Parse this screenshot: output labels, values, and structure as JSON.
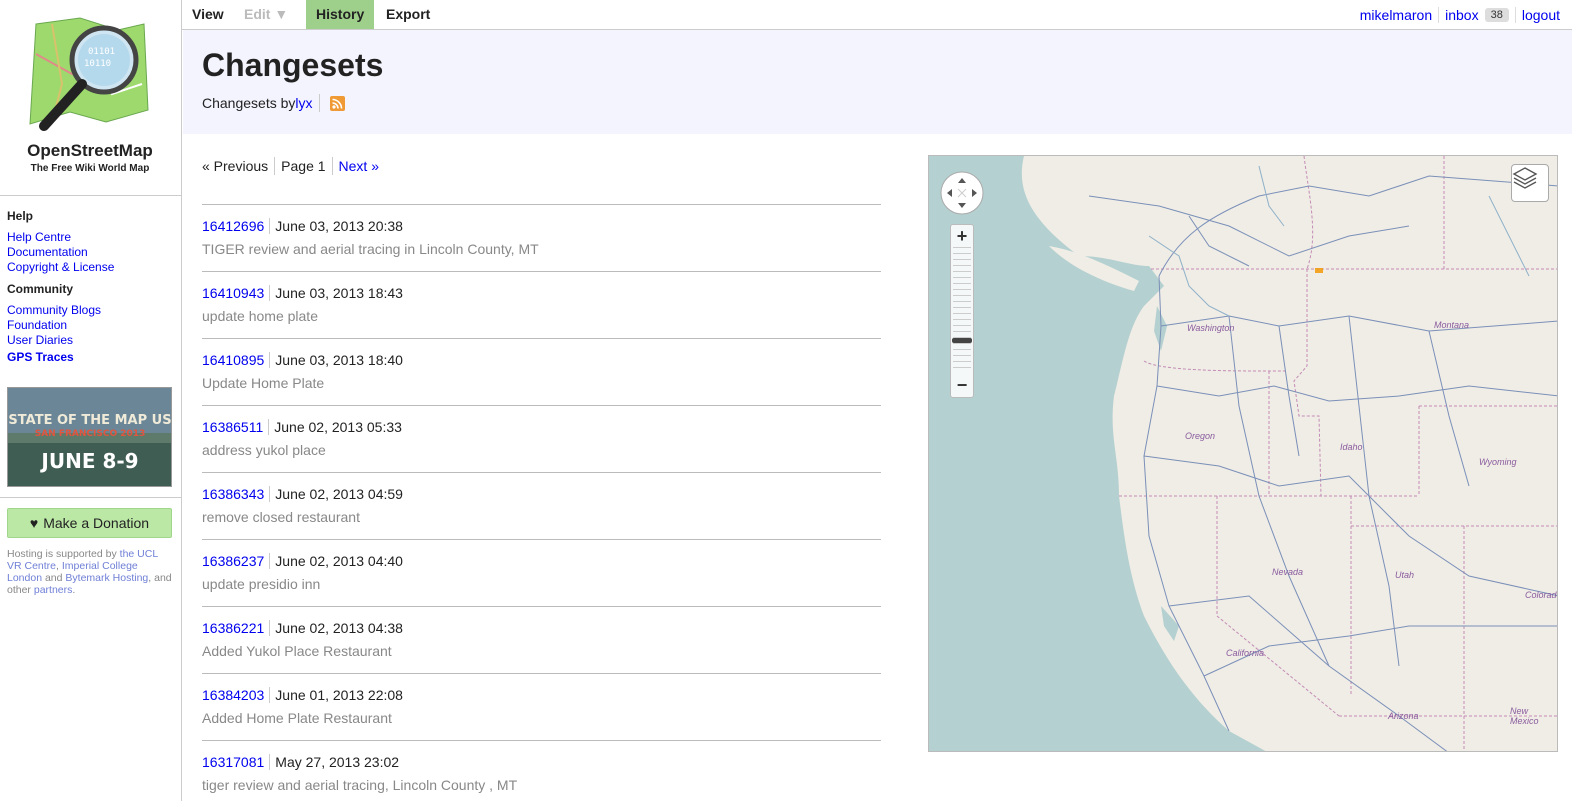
{
  "site": {
    "name": "OpenStreetMap",
    "tagline": "The Free Wiki World Map"
  },
  "sidebar": {
    "help_heading": "Help",
    "help_links": [
      "Help Centre",
      "Documentation",
      "Copyright & License"
    ],
    "community_heading": "Community",
    "community_links": [
      "Community Blogs",
      "Foundation",
      "User Diaries"
    ],
    "gps_traces": "GPS Traces",
    "banner": {
      "line1": "STATE OF THE MAP US",
      "line2": "SAN FRANCISCO 2013",
      "line3": "JUNE 8-9"
    },
    "donate_label": "Make a Donation",
    "hosting": {
      "t1": "Hosting is supported by ",
      "l1": "the UCL VR Centre",
      "t2": ", ",
      "l2": "Imperial College London",
      "t3": " and ",
      "l3": "Bytemark Hosting",
      "t4": ", and other ",
      "l4": "partners",
      "t5": "."
    }
  },
  "tabs": {
    "view": "View",
    "edit": "Edit ▼",
    "history": "History",
    "export": "Export"
  },
  "user": {
    "name": "mikelmaron",
    "inbox": "inbox",
    "inbox_count": "38",
    "logout": "logout"
  },
  "header": {
    "title": "Changesets",
    "subtitle_prefix": "Changesets by ",
    "user_link": "lyx"
  },
  "pagination": {
    "previous": "« Previous",
    "page": "Page 1",
    "next": "Next »"
  },
  "changesets": [
    {
      "id": "16412696",
      "date": "June 03, 2013 20:38",
      "comment": "TIGER review and aerial tracing in Lincoln County, MT"
    },
    {
      "id": "16410943",
      "date": "June 03, 2013 18:43",
      "comment": "update home plate"
    },
    {
      "id": "16410895",
      "date": "June 03, 2013 18:40",
      "comment": "Update Home Plate"
    },
    {
      "id": "16386511",
      "date": "June 02, 2013 05:33",
      "comment": "address yukol place"
    },
    {
      "id": "16386343",
      "date": "June 02, 2013 04:59",
      "comment": "remove closed restaurant"
    },
    {
      "id": "16386237",
      "date": "June 02, 2013 04:40",
      "comment": "update presidio inn"
    },
    {
      "id": "16386221",
      "date": "June 02, 2013 04:38",
      "comment": "Added Yukol Place Restaurant"
    },
    {
      "id": "16384203",
      "date": "June 01, 2013 22:08",
      "comment": "Added Home Plate Restaurant"
    },
    {
      "id": "16317081",
      "date": "May 27, 2013 23:02",
      "comment": "tiger review and aerial tracing, Lincoln County , MT"
    }
  ],
  "map": {
    "labels": [
      "Washington",
      "Montana",
      "Oregon",
      "Idaho",
      "Wyoming",
      "Nevada",
      "Utah",
      "Colorado",
      "California",
      "Arizona",
      "New Mexico"
    ],
    "zoom_in": "+",
    "zoom_out": "−"
  },
  "colors": {
    "link": "#0000ee",
    "history_tab": "#9ed08b",
    "header_bg": "#f4f4ff",
    "donate": "#bce8a6",
    "rss": "#f09a35",
    "water": "#b5d0d0",
    "land": "#efede6"
  }
}
